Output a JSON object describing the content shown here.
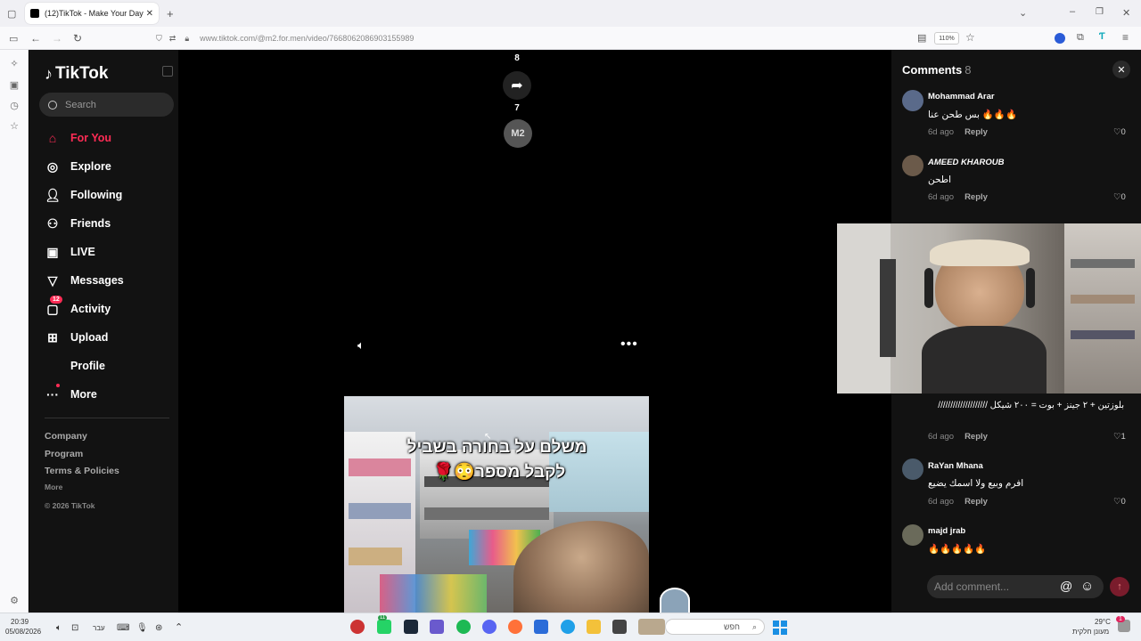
{
  "browser": {
    "tab_title": "(12)TikTok - Make Your Day",
    "url": "www.tiktok.com/@m2.for.men/video/7668062086903155989",
    "zoom": "110%"
  },
  "sidebar": {
    "logo": "TikTok",
    "search_placeholder": "Search",
    "items": [
      {
        "label": "For You",
        "icon": "home-icon"
      },
      {
        "label": "Explore",
        "icon": "compass-icon"
      },
      {
        "label": "Following",
        "icon": "following-icon"
      },
      {
        "label": "Friends",
        "icon": "friends-icon"
      },
      {
        "label": "LIVE",
        "icon": "live-icon"
      },
      {
        "label": "Messages",
        "icon": "messages-icon"
      },
      {
        "label": "Activity",
        "icon": "activity-icon",
        "badge": "12"
      },
      {
        "label": "Upload",
        "icon": "upload-icon"
      },
      {
        "label": "Profile",
        "icon": "profile-icon"
      },
      {
        "label": "More",
        "icon": "more-icon"
      }
    ],
    "footer": {
      "company": "Company",
      "program": "Program",
      "terms": "Terms & Policies",
      "more": "More",
      "copyright": "© 2026 TikTok"
    }
  },
  "video": {
    "count_top": "8",
    "share_count": "7",
    "author_avatar": "M2",
    "caption_line1": "משלם על בחורה בשביל",
    "caption_line2": "לקבל מספר😳🌹"
  },
  "comments": {
    "title": "Comments",
    "count": "8",
    "list": [
      {
        "name": "Mohammad Arar",
        "text": "بس طحن عنا 🔥🔥🔥",
        "time": "6d ago",
        "reply": "Reply",
        "likes": "0"
      },
      {
        "name": "AMEED KHAROUB",
        "text": "اطحن",
        "time": "6d ago",
        "reply": "Reply",
        "likes": "0"
      },
      {
        "name": "",
        "text": "بلوزتين + ٢ جينز + بوت = ٢٠٠ شيكل ////////////////////",
        "time": "6d ago",
        "reply": "Reply",
        "likes": "1"
      },
      {
        "name": "RaYan Mhana",
        "text": "افرم وبيع ولا اسمك يضيع",
        "time": "6d ago",
        "reply": "Reply",
        "likes": "0"
      },
      {
        "name": "majd jrab",
        "text": "🔥🔥🔥🔥🔥",
        "time": "",
        "reply": "",
        "likes": ""
      }
    ],
    "input_placeholder": "Add comment..."
  },
  "taskbar": {
    "time": "20:39",
    "date": "05/08/2026",
    "lang": "עבר",
    "search": "חפש",
    "weather_temp": "29°C",
    "weather_desc": "מעונן חלקית",
    "notif_count": "1",
    "whatsapp_count": "11"
  }
}
